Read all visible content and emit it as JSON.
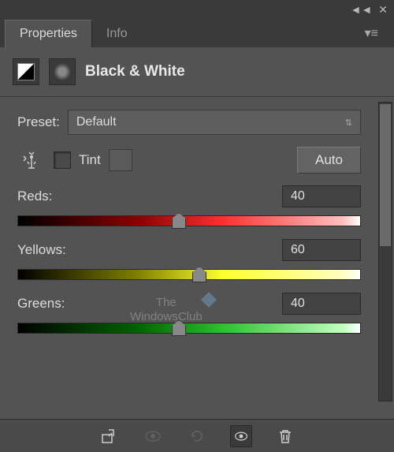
{
  "tabs": {
    "properties": "Properties",
    "info": "Info"
  },
  "panel": {
    "title": "Black & White"
  },
  "preset": {
    "label": "Preset:",
    "value": "Default"
  },
  "tint": {
    "label": "Tint"
  },
  "auto": {
    "label": "Auto"
  },
  "sliders": {
    "reds": {
      "label": "Reds:",
      "value": "40",
      "percent": 47
    },
    "yellows": {
      "label": "Yellows:",
      "value": "60",
      "percent": 53
    },
    "greens": {
      "label": "Greens:",
      "value": "40",
      "percent": 47
    }
  },
  "watermark": {
    "line1": "The",
    "line2": "WindowsClub"
  }
}
